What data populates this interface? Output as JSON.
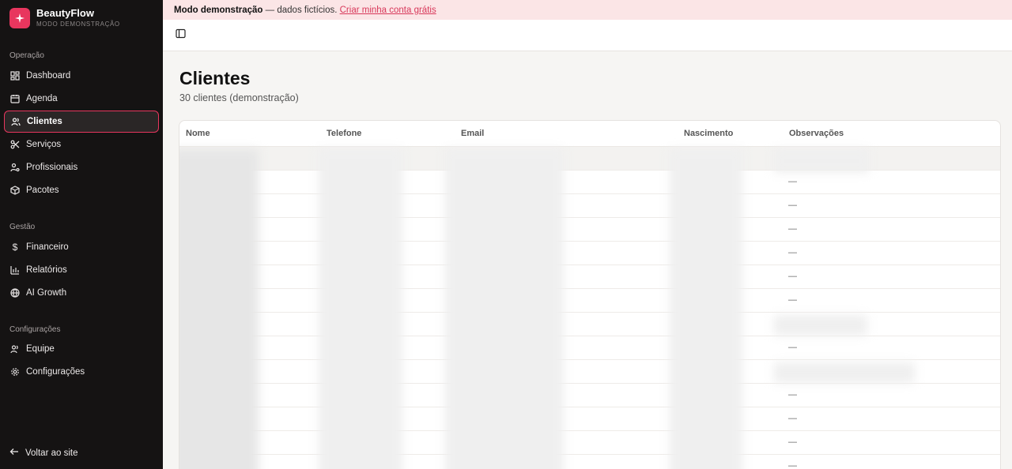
{
  "brand": {
    "name": "BeautyFlow",
    "subtitle": "MODO DEMONSTRAÇÃO"
  },
  "sidebar": {
    "sections": [
      {
        "label": "Operação"
      },
      {
        "label": "Gestão"
      },
      {
        "label": "Configurações"
      }
    ],
    "items": [
      {
        "label": "Dashboard",
        "icon": "grid-icon"
      },
      {
        "label": "Agenda",
        "icon": "calendar-icon"
      },
      {
        "label": "Clientes",
        "icon": "users-icon",
        "active": true
      },
      {
        "label": "Serviços",
        "icon": "scissors-icon"
      },
      {
        "label": "Profissionais",
        "icon": "user-cog-icon"
      },
      {
        "label": "Pacotes",
        "icon": "package-icon"
      },
      {
        "label": "Financeiro",
        "icon": "dollar-icon"
      },
      {
        "label": "Relatórios",
        "icon": "bar-chart-icon"
      },
      {
        "label": "AI Growth",
        "icon": "globe-icon"
      },
      {
        "label": "Equipe",
        "icon": "team-icon"
      },
      {
        "label": "Configurações",
        "icon": "gear-icon"
      }
    ],
    "back_label": "Voltar ao site"
  },
  "banner": {
    "bold": "Modo demonstração",
    "text": " — dados fictícios. ",
    "link": "Criar minha conta grátis"
  },
  "page": {
    "title": "Clientes",
    "subtitle": "30 clientes (demonstração)"
  },
  "table": {
    "columns": [
      "Nome",
      "Telefone",
      "Email",
      "Nascimento",
      "Observações"
    ],
    "observations": [
      "",
      "—",
      "—",
      "—",
      "—",
      "—",
      "—",
      "",
      "—",
      "",
      "—",
      "—",
      "—",
      "—"
    ]
  },
  "colors": {
    "accent": "#e8365e",
    "sidebar_bg": "#151313",
    "banner_bg": "#fbe5e6"
  }
}
